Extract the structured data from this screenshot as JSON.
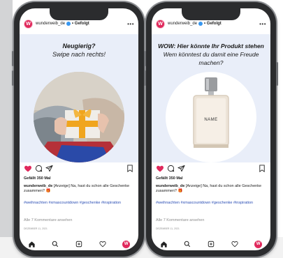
{
  "colors": {
    "accent": "#e0295c",
    "post_bg": "#e9eef9",
    "hashtag": "#2c4fb5",
    "like": "#e0295c"
  },
  "left_phone": {
    "header": {
      "avatar_letter": "W",
      "username": "wunderweib_de",
      "followed": "• Gefolgt",
      "more": "•••"
    },
    "post": {
      "line1": "Neugierig?",
      "line2": "Swipe nach rechts!"
    },
    "likes": "Gefällt 350 Mal",
    "caption_user": "wunderweib_de",
    "caption_text": "[Anzeige] Na, hast du schon alle Geschenke zusammen? 🎁",
    "hashtags": "#weihnachten #xmascountdown #geschenke #inspiration",
    "comments": "Alle 7 Kommentare ansehen",
    "date": "DEZEMBER 11, 2021",
    "nav_avatar_letter": "W",
    "icons": [
      "heart-icon",
      "comment-icon",
      "share-icon",
      "bookmark-icon",
      "home-icon",
      "search-icon",
      "add-icon",
      "activity-icon"
    ]
  },
  "right_phone": {
    "header": {
      "avatar_letter": "W",
      "username": "wunderweib_de",
      "followed": "• Gefolgt",
      "more": "•••"
    },
    "post": {
      "line1": "WOW: Hier könnte Ihr Produkt stehen",
      "line2": "Wem könntest du damit eine Freude",
      "line3": "machen?"
    },
    "product_label": "NAME",
    "likes": "Gefällt 350 Mal",
    "caption_user": "wunderweib_de",
    "caption_text": "[Anzeige] Na, hast du schon alle Geschenke zusammen? 🎁",
    "hashtags": "#weihnachten #xmascountdown #geschenke #inspiration",
    "comments": "Alle 7 Kommentare ansehen",
    "date": "DEZEMBER 11, 2021",
    "nav_avatar_letter": "W"
  }
}
